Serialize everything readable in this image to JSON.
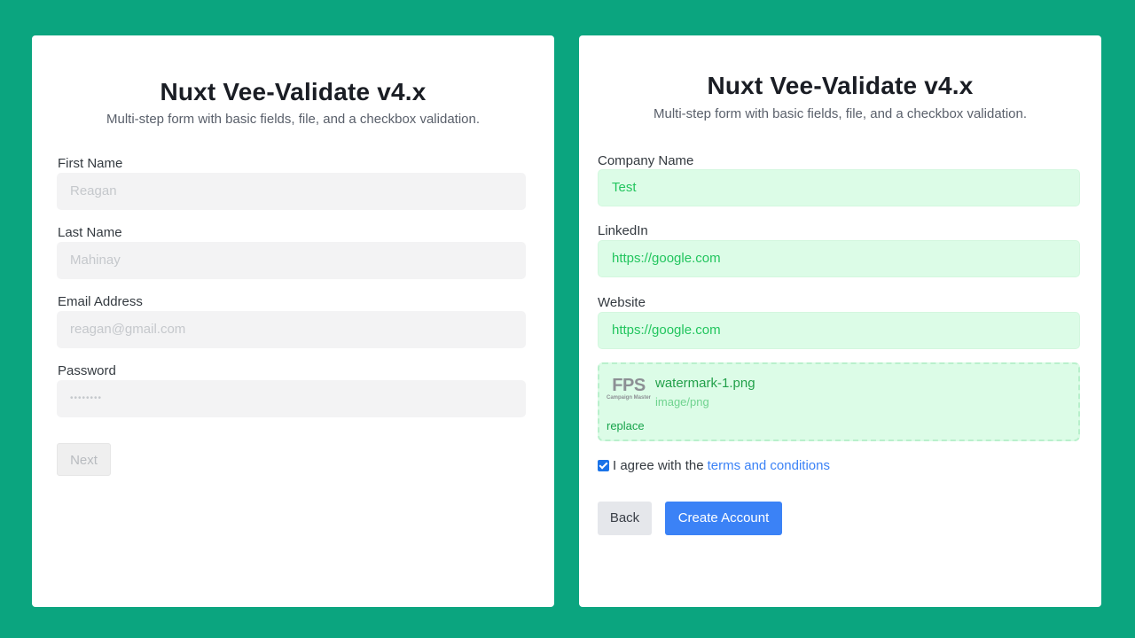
{
  "left_card": {
    "title": "Nuxt Vee-Validate v4.x",
    "subtitle": "Multi-step form with basic fields, file, and a checkbox validation.",
    "fields": [
      {
        "label": "First Name",
        "value": "Reagan"
      },
      {
        "label": "Last Name",
        "value": "Mahinay"
      },
      {
        "label": "Email Address",
        "value": "reagan@gmail.com"
      },
      {
        "label": "Password",
        "value": "••••••••"
      }
    ],
    "next_label": "Next"
  },
  "right_card": {
    "title": "Nuxt Vee-Validate v4.x",
    "subtitle": "Multi-step form with basic fields, file, and a checkbox validation.",
    "fields": [
      {
        "label": "Company Name",
        "value": "Test"
      },
      {
        "label": "LinkedIn",
        "value": "https://google.com"
      },
      {
        "label": "Website",
        "value": "https://google.com"
      }
    ],
    "file": {
      "name": "watermark-1.png",
      "type": "image/png",
      "replace_label": "replace",
      "thumb_text": "FPS",
      "thumb_subtext": "Campaign Master"
    },
    "agree": {
      "checked": true,
      "text": "I agree with the",
      "link_text": "terms and conditions"
    },
    "back_label": "Back",
    "create_label": "Create Account"
  },
  "colors": {
    "background": "#0ba57f",
    "primary": "#3b82f6",
    "valid_bg": "#dcfce7",
    "valid_text": "#22c55e"
  }
}
